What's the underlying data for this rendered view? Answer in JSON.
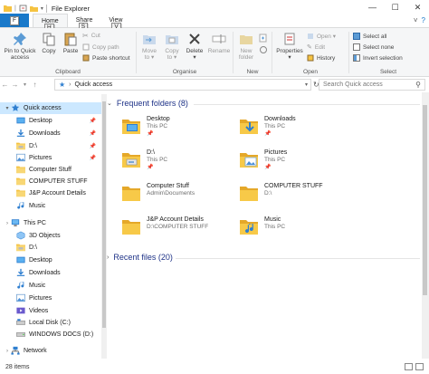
{
  "window": {
    "title": "File Explorer",
    "controls": [
      "—",
      "☐",
      "✕"
    ]
  },
  "tabs": {
    "file": "F",
    "file_keytip": "F",
    "home": "Home",
    "home_keytip": "H",
    "share": "Share",
    "share_keytip": "S",
    "view": "View",
    "view_keytip": "V"
  },
  "ribbon": {
    "clipboard": {
      "label": "Clipboard",
      "pin": "Pin to Quick\naccess",
      "copy": "Copy",
      "paste": "Paste",
      "cut": "Cut",
      "copy_path": "Copy path",
      "paste_shortcut": "Paste shortcut"
    },
    "organise": {
      "label": "Organise",
      "move_to": "Move\nto ▾",
      "copy_to": "Copy\nto ▾",
      "delete": "Delete\n▾",
      "rename": "Rename"
    },
    "new": {
      "label": "New",
      "new_folder": "New\nfolder"
    },
    "open": {
      "label": "Open",
      "properties": "Properties\n▾",
      "open": "Open ▾",
      "edit": "Edit",
      "history": "History"
    },
    "select": {
      "label": "Select",
      "select_all": "Select all",
      "select_none": "Select none",
      "invert_selection": "Invert selection"
    }
  },
  "address": {
    "location": "Quick access",
    "search_placeholder": "Search Quick access"
  },
  "nav": {
    "items": [
      {
        "label": "Quick access",
        "icon": "star-icon",
        "selected": true,
        "pinned": false,
        "expand": "▾",
        "indent": 0
      },
      {
        "label": "Desktop",
        "icon": "desktop-folder-icon",
        "pinned": true,
        "indent": 1
      },
      {
        "label": "Downloads",
        "icon": "downloads-folder-icon",
        "pinned": true,
        "indent": 1
      },
      {
        "label": "D:\\",
        "icon": "drive-folder-icon",
        "pinned": true,
        "indent": 1
      },
      {
        "label": "Pictures",
        "icon": "pictures-folder-icon",
        "pinned": true,
        "indent": 1
      },
      {
        "label": "Computer Stuff",
        "icon": "folder-icon",
        "pinned": false,
        "indent": 1
      },
      {
        "label": "COMPUTER STUFF",
        "icon": "folder-icon",
        "pinned": false,
        "indent": 1
      },
      {
        "label": "J&P Account Details",
        "icon": "folder-icon",
        "pinned": false,
        "indent": 1
      },
      {
        "label": "Music",
        "icon": "music-folder-icon",
        "pinned": false,
        "indent": 1
      },
      {
        "label": "This PC",
        "icon": "this-pc-icon",
        "pinned": false,
        "expand": "›",
        "indent": 0
      },
      {
        "label": "3D Objects",
        "icon": "3d-objects-icon",
        "pinned": false,
        "indent": 1
      },
      {
        "label": "D:\\",
        "icon": "drive-folder-icon",
        "pinned": false,
        "indent": 1
      },
      {
        "label": "Desktop",
        "icon": "desktop-folder-icon",
        "pinned": false,
        "indent": 1
      },
      {
        "label": "Downloads",
        "icon": "downloads-folder-icon",
        "pinned": false,
        "indent": 1
      },
      {
        "label": "Music",
        "icon": "music-folder-icon",
        "pinned": false,
        "indent": 1
      },
      {
        "label": "Pictures",
        "icon": "pictures-folder-icon",
        "pinned": false,
        "indent": 1
      },
      {
        "label": "Videos",
        "icon": "videos-folder-icon",
        "pinned": false,
        "indent": 1
      },
      {
        "label": "Local Disk (C:)",
        "icon": "local-disk-icon",
        "pinned": false,
        "indent": 1
      },
      {
        "label": "WINDOWS DOCS (D:)",
        "icon": "drive-icon",
        "pinned": false,
        "indent": 1
      },
      {
        "label": "Network",
        "icon": "network-icon",
        "pinned": false,
        "expand": "›",
        "indent": 0
      }
    ]
  },
  "content": {
    "frequent_header": "Frequent folders (8)",
    "recent_header": "Recent files (20)",
    "folders": [
      {
        "name": "Desktop",
        "sub": "This PC",
        "pin": "📌",
        "icon": "desktop-folder-icon"
      },
      {
        "name": "Downloads",
        "sub": "This PC",
        "pin": "📌",
        "icon": "downloads-folder-icon"
      },
      {
        "name": "D:\\",
        "sub": "This PC",
        "pin": "📌",
        "icon": "drive-folder-icon"
      },
      {
        "name": "Pictures",
        "sub": "This PC",
        "pin": "📌",
        "icon": "pictures-folder-icon"
      },
      {
        "name": "Computer Stuff",
        "sub": "Admin\\Documents",
        "pin": "",
        "icon": "folder-icon"
      },
      {
        "name": "COMPUTER STUFF",
        "sub": "D:\\",
        "pin": "",
        "icon": "folder-icon"
      },
      {
        "name": "J&P Account Details",
        "sub": "D:\\COMPUTER STUFF",
        "pin": "",
        "icon": "folder-icon"
      },
      {
        "name": "Music",
        "sub": "This PC",
        "pin": "",
        "icon": "music-folder-icon"
      }
    ]
  },
  "status": {
    "items": "28 items"
  },
  "colors": {
    "accent": "#1979ca",
    "selection": "#cce8ff",
    "folder": "#f5c342",
    "section_title": "#1e3287"
  }
}
